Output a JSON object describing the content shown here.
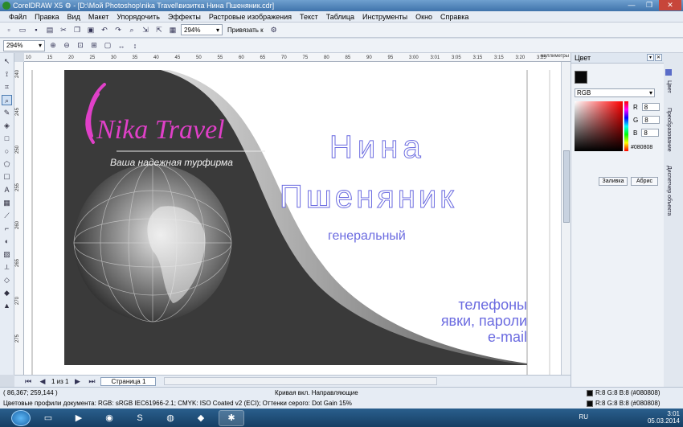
{
  "window": {
    "title": "CorelDRAW X5 ⚙ - [D:\\Мой Photoshop\\nika Travel\\визитка Нина Пшеняник.cdr]"
  },
  "menu": [
    "Файл",
    "Правка",
    "Вид",
    "Макет",
    "Упорядочить",
    "Эффекты",
    "Растровые изображения",
    "Текст",
    "Таблица",
    "Инструменты",
    "Окно",
    "Справка"
  ],
  "toolbar": {
    "zoom": "294%",
    "snap_label": "Привязать к"
  },
  "toolbar2": {
    "zoom": "294%"
  },
  "ruler": {
    "h_ticks": [
      "10",
      "15",
      "20",
      "25",
      "30",
      "35",
      "40",
      "45",
      "50",
      "55",
      "60",
      "65",
      "70",
      "75",
      "80",
      "85",
      "90",
      "95",
      "3:00",
      "3:01",
      "3:05",
      "3:15",
      "3:15",
      "3:20",
      "3:25"
    ],
    "units": "миллиметры",
    "v_ticks": [
      "240",
      "245",
      "250",
      "255",
      "260",
      "265",
      "270",
      "275"
    ]
  },
  "card": {
    "logo_text": "Nika Travel",
    "tagline": "Ваша надежная турфирма",
    "first_name": "Нина",
    "last_name": "Пшеняник",
    "position": "генеральный",
    "contacts": [
      "телефоны",
      "явки, пароли",
      "e-mail"
    ],
    "colors": {
      "dark": "#3a3a3a",
      "accent": "#e040c8",
      "text": "#6b6be0"
    }
  },
  "pagebar": {
    "page_count": "1 из 1",
    "page_tab": "Страница 1"
  },
  "status": {
    "coords": "( 86,367; 259,144 )",
    "object": "Кривая вкл. Направляющие",
    "profiles": "Цветовые профили документа: RGB: sRGB IEC61966-2.1; CMYK: ISO Coated v2 (ECI); Оттенки серого: Dot Gain 15%",
    "fill": "R:8 G:8 B:8 (#080808)",
    "outline": "R:8 G:8 B:8 (#080808)"
  },
  "docker": {
    "title": "Цвет",
    "model": "RGB",
    "r_label": "R",
    "r": "8",
    "g_label": "G",
    "g": "8",
    "b_label": "B",
    "b": "8",
    "hex": "#080808",
    "fill_btn": "Заливка",
    "outline_btn": "Абрис",
    "tabs": [
      "Цвет",
      "Преобразование",
      "Диспетчер объекта"
    ]
  },
  "taskbar": {
    "lang": "RU",
    "time": "3:01",
    "date": "05.03.2014"
  }
}
